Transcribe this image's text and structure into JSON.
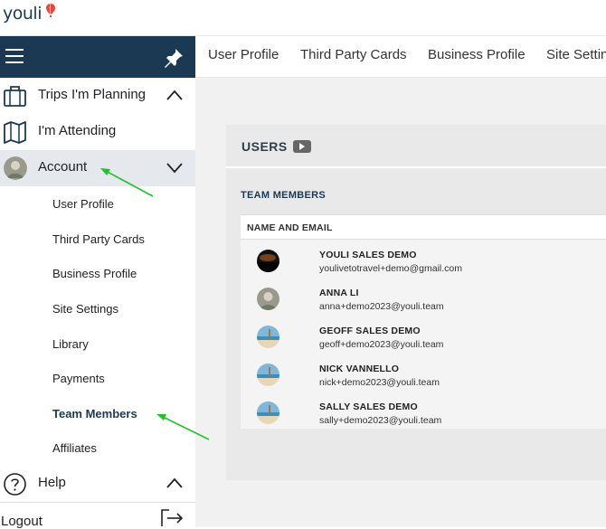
{
  "app": {
    "logo_text": "youli",
    "colors": {
      "nav_dark": "#1b3952",
      "active_row": "#e5e9ee",
      "annotation_arrow": "#22c22a"
    }
  },
  "sidebar": {
    "sections": [
      {
        "label": "Trips I'm Planning",
        "icon": "suitcase-icon",
        "chevron": "up"
      },
      {
        "label": "I'm Attending",
        "icon": "map-icon"
      },
      {
        "label": "Account",
        "icon": "avatar",
        "chevron": "down",
        "active": true
      },
      {
        "label": "Help",
        "icon": "question-circle-icon",
        "chevron": "up"
      },
      {
        "label": "Logout",
        "icon": "logout-icon"
      }
    ],
    "account_items": [
      "User Profile",
      "Third Party Cards",
      "Business Profile",
      "Site Settings",
      "Library",
      "Payments",
      "Team Members",
      "Affiliates"
    ],
    "current_item": "Team Members"
  },
  "tabs": [
    "User Profile",
    "Third Party Cards",
    "Business Profile",
    "Site Settings"
  ],
  "users_panel": {
    "title": "USERS",
    "section_title": "TEAM MEMBERS",
    "column_header": "NAME AND EMAIL",
    "members": [
      {
        "name": "YOULI SALES DEMO",
        "email": "youlivetotravel+demo@gmail.com",
        "avatar": "dark"
      },
      {
        "name": "ANNA LI",
        "email": "anna+demo2023@youli.team",
        "avatar": "grey"
      },
      {
        "name": "GEOFF SALES DEMO",
        "email": "geoff+demo2023@youli.team",
        "avatar": "beach"
      },
      {
        "name": "NICK VANNELLO",
        "email": "nick+demo2023@youli.team",
        "avatar": "beach"
      },
      {
        "name": "SALLY SALES DEMO",
        "email": "sally+demo2023@youli.team",
        "avatar": "beach"
      }
    ]
  }
}
